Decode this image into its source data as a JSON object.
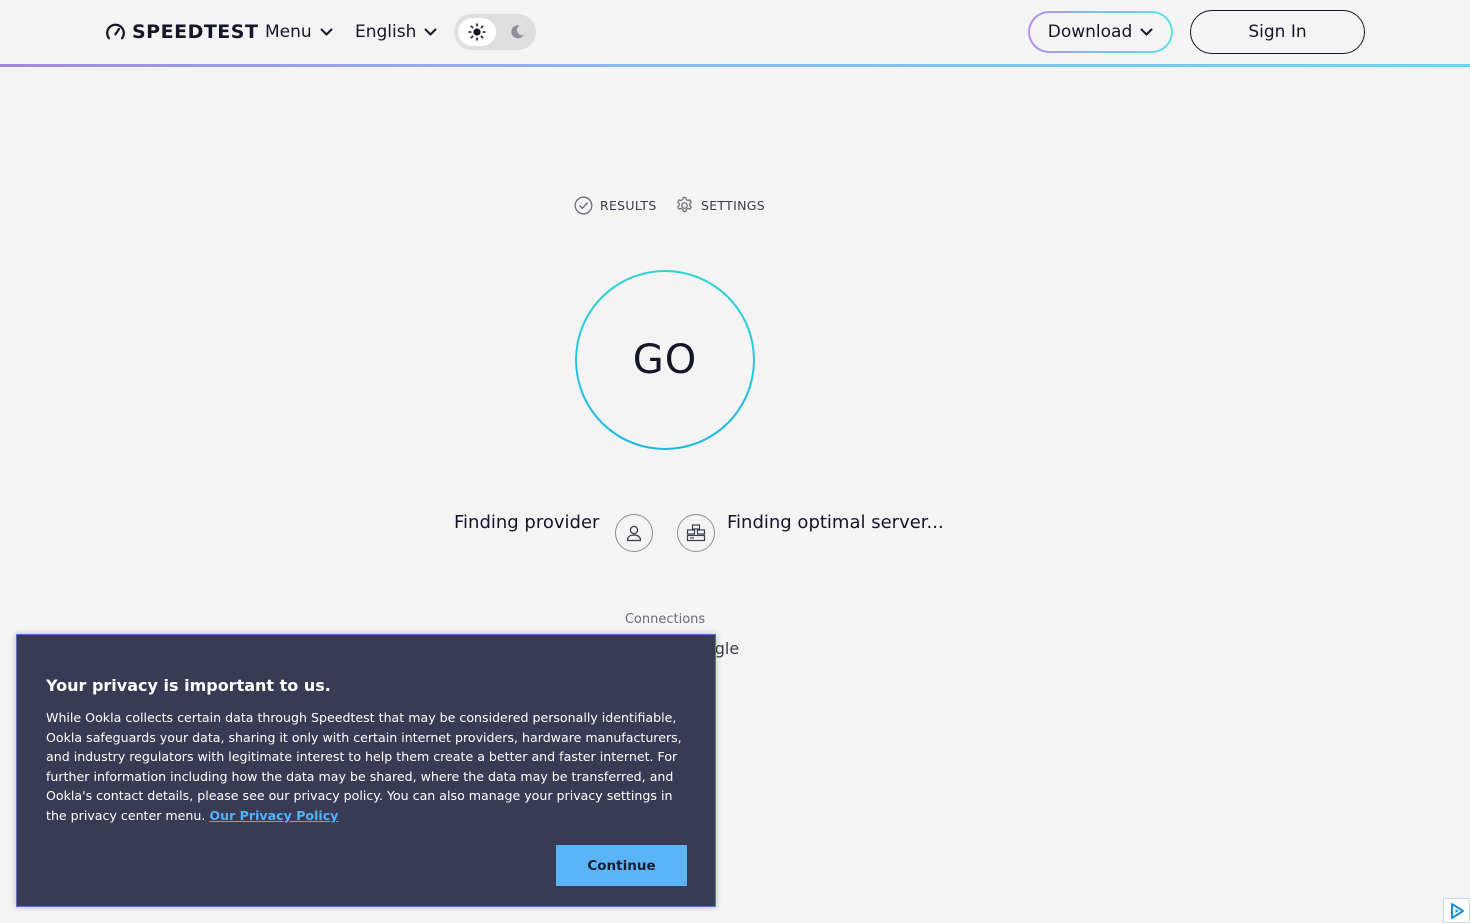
{
  "header": {
    "logo_text": "SPEEDTEST",
    "menu_label": "Menu",
    "language_label": "English",
    "download_label": "Download",
    "signin_label": "Sign In"
  },
  "subnav": {
    "results_label": "RESULTS",
    "settings_label": "SETTINGS"
  },
  "main": {
    "go_label": "GO",
    "provider_text": "Finding provider",
    "server_text": "Finding optimal server...",
    "connections_label": "Connections",
    "connections_value": "Single"
  },
  "privacy": {
    "title": "Your privacy is important to us.",
    "body": "While Ookla collects certain data through Speedtest that may be considered personally identifiable, Ookla safeguards your data, sharing it only with certain internet providers, hardware manufacturers, and industry regulators with legitimate interest to help them create a better and faster internet. For further information including how the data may be shared, where the data may be transferred, and Ookla's contact details, please see our privacy policy. You can also manage your privacy settings in the privacy center menu.",
    "link_label": "Our Privacy Policy",
    "continue_label": "Continue"
  },
  "icons": {
    "logo": "speedometer-icon",
    "sun": "sun-icon",
    "moon": "moon-icon",
    "results": "check-circle-icon",
    "settings": "gear-icon",
    "provider": "person-icon",
    "server": "server-stack-icon",
    "ad": "adchoices-icon"
  },
  "colors": {
    "background": "#f4f4f4",
    "text": "#141526",
    "go_ring": "#1ab9e0",
    "modal_bg": "#393b55",
    "link": "#4fb3ff",
    "continue_bg": "#5ab4f5"
  }
}
